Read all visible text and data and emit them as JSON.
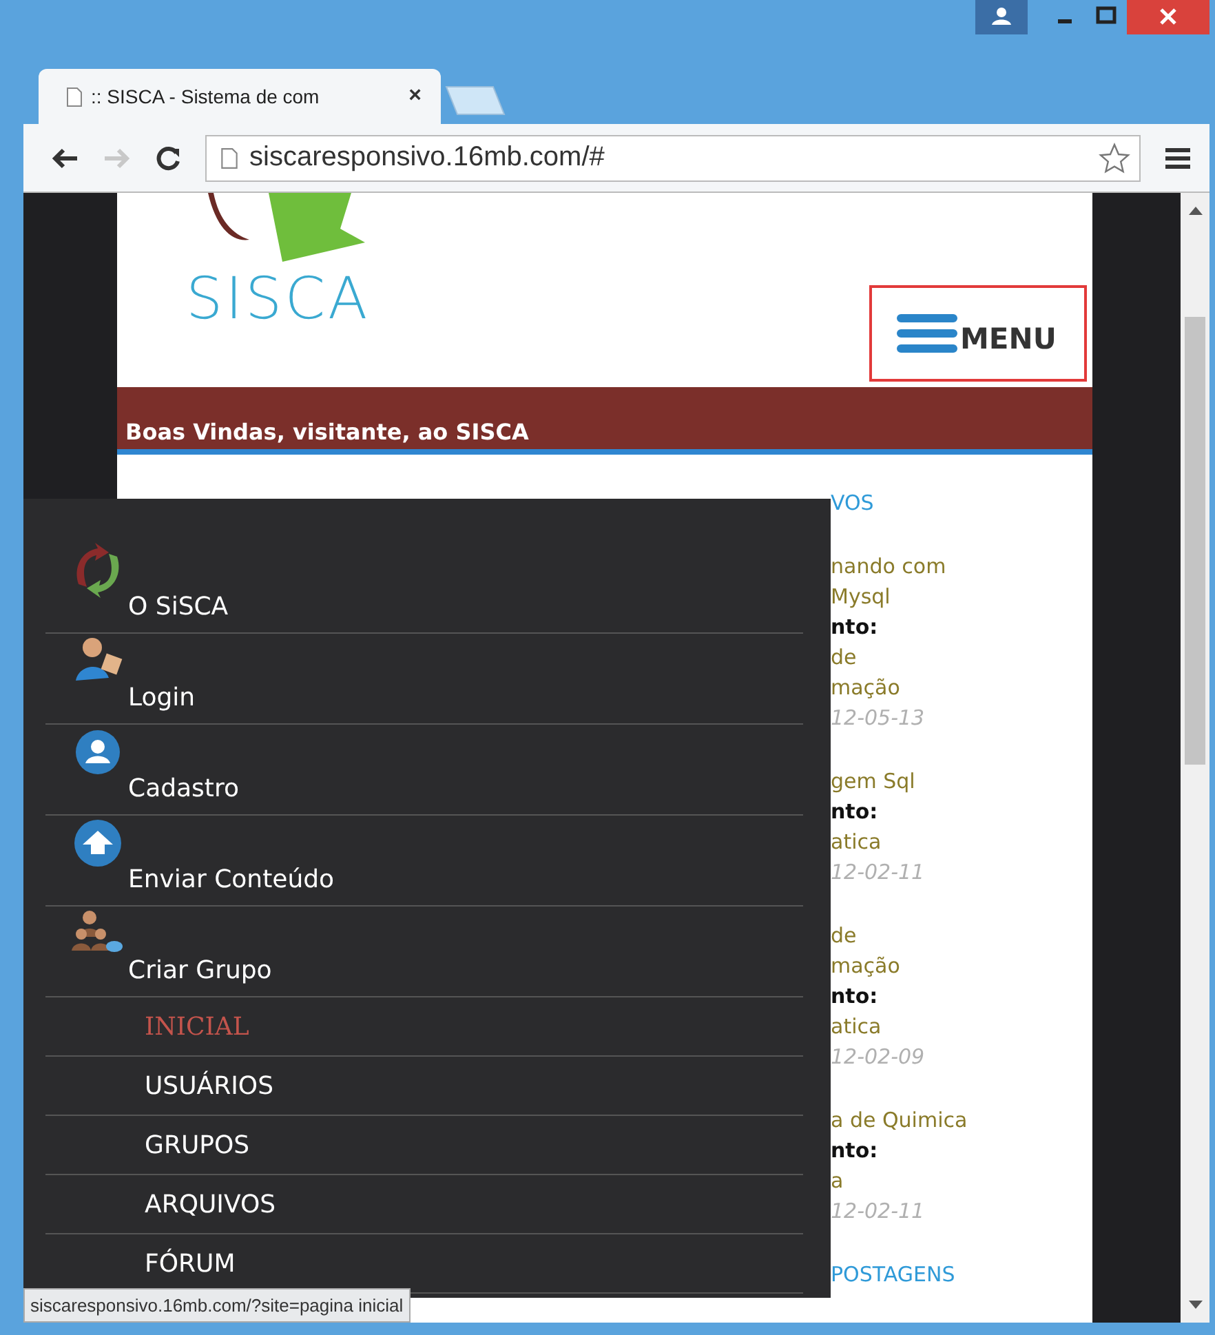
{
  "browser": {
    "tab_title": ":: SISCA - Sistema de com",
    "tab_close": "×",
    "forward_disabled": true,
    "address": "siscaresponsivo.16mb.com/#"
  },
  "page": {
    "logo": "SISCA",
    "menu_button": "MENU",
    "welcome": "Boas Vindas, visitante, ao SISCA",
    "feed": {
      "heading": "VOS",
      "posts": [
        {
          "title": [
            "nando com",
            "Mysql"
          ],
          "label": "nto:",
          "category": [
            "de",
            "mação"
          ],
          "date": "12-05-13"
        },
        {
          "title": [
            "gem Sql"
          ],
          "label": "nto:",
          "category": [
            "atica"
          ],
          "date": "12-02-11"
        },
        {
          "title": [
            "de",
            "mação"
          ],
          "label": "nto:",
          "category": [
            "atica"
          ],
          "date": "12-02-09"
        },
        {
          "title": [
            "a de Quimica"
          ],
          "label": "nto:",
          "category": [
            "a"
          ],
          "date": "12-02-11"
        }
      ],
      "footer_heading": "POSTAGENS"
    }
  },
  "menu": {
    "items": [
      {
        "kind": "icon",
        "label": "O SiSCA",
        "selected": false
      },
      {
        "kind": "icon",
        "label": "Login",
        "selected": false
      },
      {
        "kind": "icon",
        "label": "Cadastro",
        "selected": false
      },
      {
        "kind": "icon",
        "label": "Enviar Conteúdo",
        "selected": false
      },
      {
        "kind": "icon",
        "label": "Criar Grupo",
        "selected": false
      },
      {
        "kind": "text",
        "label": "INICIAL",
        "selected": true
      },
      {
        "kind": "text",
        "label": "USUÁRIOS",
        "selected": false
      },
      {
        "kind": "text",
        "label": "GRUPOS",
        "selected": false
      },
      {
        "kind": "text",
        "label": "ARQUIVOS",
        "selected": false
      },
      {
        "kind": "text",
        "label": "FÓRUM",
        "selected": false
      }
    ]
  },
  "status_url": "siscaresponsivo.16mb.com/?site=pagina inicial"
}
